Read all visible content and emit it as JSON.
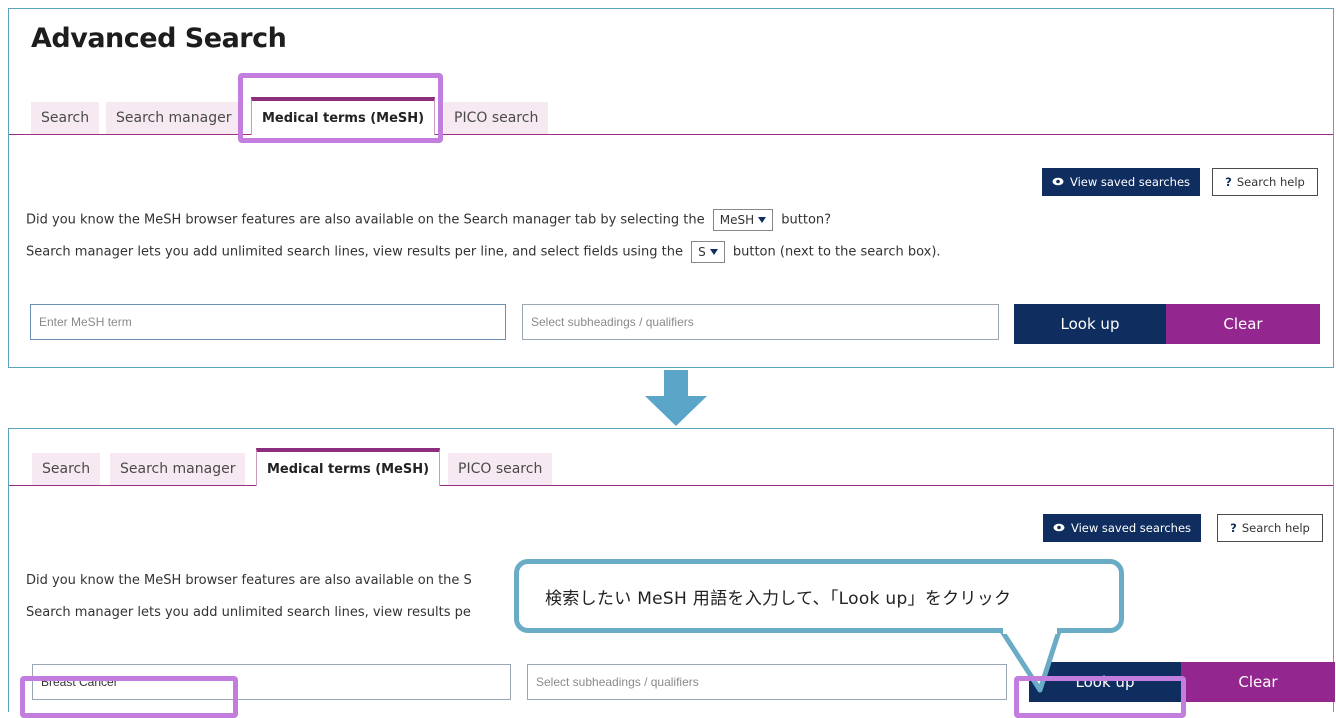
{
  "top": {
    "title": "Advanced Search",
    "tabs": [
      "Search",
      "Search manager",
      "Medical terms (MeSH)",
      "PICO search"
    ],
    "active_tab": "Medical terms (MeSH)",
    "view_saved": "View saved searches",
    "search_help": "Search help",
    "info_line1_a": "Did you know the MeSH browser features are also available on the Search manager tab by selecting the",
    "info_line1_btn": "MeSH",
    "info_line1_b": "button?",
    "info_line2_a": "Search manager lets you add unlimited search lines, view results per line, and select fields using the",
    "info_line2_btn": "S",
    "info_line2_b": "button (next to the search box).",
    "mesh_placeholder": "Enter MeSH term",
    "subheadings_placeholder": "Select subheadings / qualifiers",
    "look_up": "Look up",
    "clear": "Clear"
  },
  "bottom": {
    "tabs": [
      "Search",
      "Search manager",
      "Medical terms (MeSH)",
      "PICO search"
    ],
    "view_saved": "View saved searches",
    "search_help": "Search help",
    "info_line1": "Did you know the MeSH browser features are also available on the S",
    "info_line2": "Search manager lets you add unlimited search lines, view results pe",
    "mesh_value": "Breast Cancer",
    "subheadings_placeholder": "Select subheadings / qualifiers",
    "look_up": "Look up",
    "clear": "Clear"
  },
  "callout": {
    "text": "検索したい MeSH 用語を入力して、「Look up」をクリック"
  },
  "colors": {
    "navy": "#0f2e5f",
    "purple": "#93268f",
    "highlight": "#c27ddf",
    "callout_border": "#6aabc5",
    "panel_border": "#5aa5bd"
  },
  "icons": [
    "eye-icon",
    "question-icon",
    "caret-down-icon",
    "down-arrow-icon"
  ]
}
